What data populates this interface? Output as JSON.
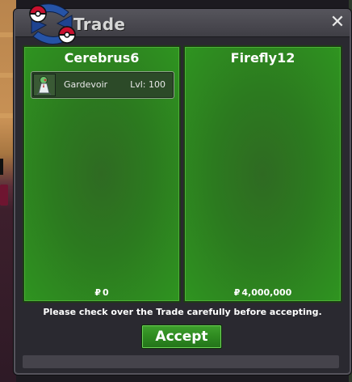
{
  "window": {
    "title": "Trade",
    "close_symbol": "✕"
  },
  "panels": [
    {
      "player": "Cerebrus6",
      "pokemon": [
        {
          "name": "Gardevoir",
          "level": "Lvl: 100",
          "sprite": "gardevoir-sprite"
        }
      ],
      "money_symbol": "₽",
      "money": "0"
    },
    {
      "player": "Firefly12",
      "pokemon": [],
      "money_symbol": "₽",
      "money": "4,000,000"
    }
  ],
  "notice": "Please check over the Trade carefully before accepting.",
  "accept_label": "Accept",
  "colors": {
    "panel_green": "#2c7a1f",
    "accept_green": "#2e8a20",
    "titlebar": "#4a4950",
    "logo_blue": "#2653a6",
    "logo_red": "#c8102e"
  }
}
